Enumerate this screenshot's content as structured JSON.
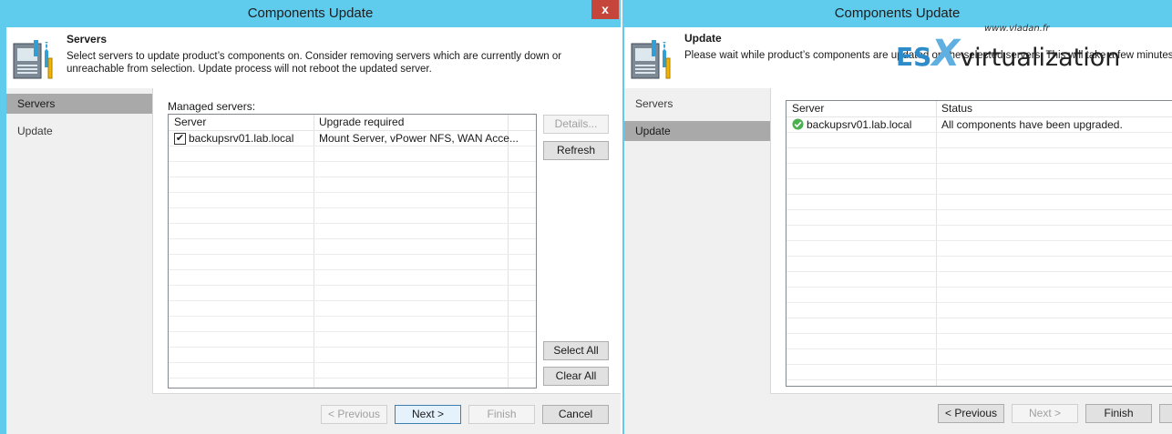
{
  "left_window": {
    "title": "Components Update",
    "close_label": "x",
    "header": {
      "title": "Servers",
      "description": "Select servers to update product’s components on. Consider removing servers which are currently down or unreachable from selection. Update process will not reboot the updated server."
    },
    "nav": {
      "items": [
        {
          "label": "Servers"
        },
        {
          "label": "Update"
        }
      ]
    },
    "grid_label": "Managed servers:",
    "columns": [
      "Server",
      "Upgrade required"
    ],
    "rows": [
      {
        "server": "backupsrv01.lab.local",
        "upgrade": "Mount Server, vPower NFS, WAN Acce...",
        "checked": true
      }
    ],
    "side_buttons": {
      "details": "Details...",
      "refresh": "Refresh",
      "select_all": "Select All",
      "clear_all": "Clear All"
    },
    "footer_buttons": {
      "previous": "< Previous",
      "next": "Next >",
      "finish": "Finish",
      "cancel": "Cancel"
    }
  },
  "right_window": {
    "title": "Components Update",
    "header": {
      "title": "Update",
      "description": "Please wait while product’s components are updated on the selected servers. This will take a few minutes."
    },
    "nav": {
      "items": [
        {
          "label": "Servers"
        },
        {
          "label": "Update"
        }
      ]
    },
    "columns": [
      "Server",
      "Status"
    ],
    "rows": [
      {
        "server": "backupsrv01.lab.local",
        "status": "All components have been upgraded.",
        "icon": "success-check-icon"
      }
    ],
    "footer_buttons": {
      "previous": "< Previous",
      "next": "Next >",
      "finish": "Finish"
    }
  },
  "watermark": {
    "url": "www.vladan.fr",
    "brand_es": "ES",
    "brand_x": "X",
    "brand_rest": "virtualization"
  },
  "colors": {
    "titlebar": "#5fcbed",
    "close": "#c5453b",
    "nav_selected": "#a9a9a9",
    "success": "#4caf50"
  }
}
